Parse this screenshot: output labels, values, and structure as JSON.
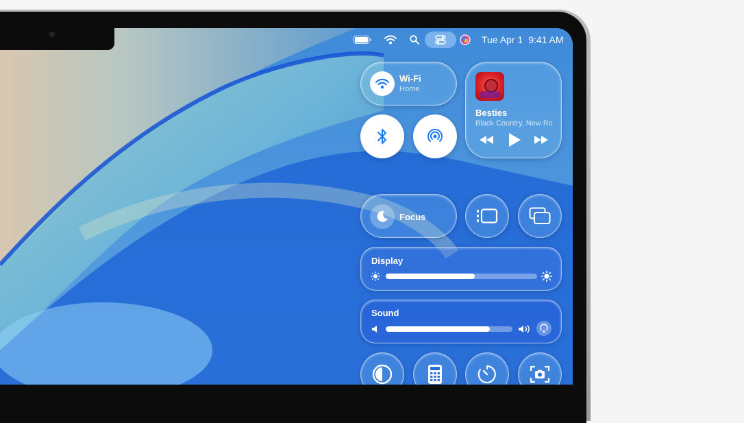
{
  "menubar": {
    "date": "Tue Apr 1",
    "time": "9:41 AM",
    "icons": [
      "battery-icon",
      "wifi-icon",
      "search-icon",
      "control-center-icon",
      "siri-icon"
    ]
  },
  "control_center": {
    "wifi": {
      "title": "Wi-Fi",
      "subtitle": "Home",
      "icon": "wifi-icon"
    },
    "bluetooth": {
      "icon": "bluetooth-icon"
    },
    "airdrop": {
      "icon": "airdrop-icon"
    },
    "now_playing": {
      "title": "Besties",
      "artist": "Black Country, New Road",
      "controls": [
        "rewind-icon",
        "play-icon",
        "fast-forward-icon"
      ]
    },
    "focus": {
      "title": "Focus",
      "icon": "moon-icon"
    },
    "stage_manager": {
      "icon": "stage-manager-icon"
    },
    "screen_mirroring": {
      "icon": "screen-mirroring-icon"
    },
    "display": {
      "title": "Display",
      "level": 0.59
    },
    "sound": {
      "title": "Sound",
      "level": 0.82
    },
    "bottom_row": [
      "dark-mode-icon",
      "calculator-icon",
      "timer-icon",
      "screenshot-icon"
    ]
  },
  "colors": {
    "accent_blue": "#1a7cf0",
    "tile_glass": "#8ccdf0"
  }
}
